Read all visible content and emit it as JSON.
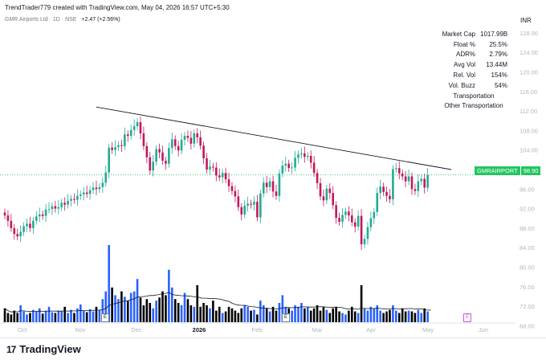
{
  "header": {
    "attribution": "TrendTrader779 created with TradingView.com, May 04, 2026 16:57 UTC+5:30",
    "symbol_line": "GMR Airports Ltd · 1D · NSE",
    "change": "+2.47 (+2.56%)",
    "currency": "INR"
  },
  "stats": [
    {
      "label": "Market Cap",
      "value": "1017.99B"
    },
    {
      "label": "Float %",
      "value": "25.5%"
    },
    {
      "label": "ADR%",
      "value": "2.79%"
    },
    {
      "label": "Avg Vol",
      "value": "13.44M"
    },
    {
      "label": "Rel. Vol",
      "value": "154%"
    },
    {
      "label": "Vol. Buzz",
      "value": "54%"
    }
  ],
  "sector": "Transportation",
  "industry": "Other Transportation",
  "price_tag": {
    "symbol": "GMRAIRPORT",
    "value": "98.90"
  },
  "earnings_marker": "E",
  "brand": {
    "mark": "17",
    "name": "TradingView"
  },
  "colors": {
    "up": "#22ab94",
    "down": "#c2185b",
    "up_vol": "#2962ff",
    "down_vol": "#000000",
    "trendline": "#131722",
    "price_line": "#22c55e",
    "axis_text": "#b2b5be"
  },
  "chart_data": {
    "type": "candlestick",
    "y_axis_ticks": [
      68,
      72,
      76,
      80,
      84,
      88,
      92,
      96,
      100,
      104,
      108,
      112,
      116,
      120,
      124,
      128
    ],
    "x_axis_ticks": [
      "Oct",
      "Nov",
      "Dec",
      "2026",
      "Feb",
      "Mar",
      "Apr",
      "May",
      "Jun"
    ],
    "ylim": [
      68,
      130
    ],
    "last_price": 98.9,
    "trendline": [
      {
        "date": "2025-11-14",
        "price": 112.8
      },
      {
        "date": "2026-05-15",
        "price": 100.0
      }
    ],
    "closes": [
      90.6,
      89.5,
      88.0,
      86.8,
      86.3,
      87.2,
      88.4,
      88.9,
      88.0,
      89.5,
      90.4,
      90.8,
      90.5,
      91.8,
      91.9,
      92.5,
      92.0,
      92.3,
      93.2,
      92.8,
      93.6,
      94.0,
      93.8,
      94.6,
      94.9,
      95.3,
      95.0,
      95.8,
      96.3,
      96.0,
      96.4,
      97.3,
      99.4,
      104.5,
      104.0,
      104.6,
      105.0,
      104.8,
      107.2,
      106.9,
      108.1,
      108.9,
      109.7,
      107.4,
      104.8,
      102.5,
      99.8,
      101.6,
      104.2,
      103.5,
      101.8,
      101.2,
      104.4,
      106.2,
      104.8,
      103.9,
      106.1,
      106.9,
      106.5,
      105.3,
      107.4,
      106.6,
      104.9,
      102.3,
      100.0,
      100.6,
      100.4,
      98.8,
      98.4,
      99.3,
      98.0,
      96.6,
      95.6,
      94.5,
      92.3,
      90.8,
      92.6,
      93.0,
      92.8,
      93.4,
      90.2,
      95.1,
      97.3,
      96.4,
      97.6,
      95.5,
      94.6,
      99.2,
      100.8,
      101.2,
      100.3,
      100.4,
      102.4,
      103.1,
      103.3,
      102.6,
      102.8,
      101.4,
      99.3,
      97.2,
      94.5,
      93.7,
      96.1,
      95.2,
      92.7,
      90.1,
      89.3,
      90.7,
      91.4,
      90.6,
      89.2,
      88.3,
      90.5,
      84.7,
      85.8,
      88.2,
      90.0,
      91.3,
      95.2,
      96.5,
      95.4,
      94.6,
      93.9,
      100.1,
      100.3,
      99.2,
      98.6,
      97.6,
      98.6,
      96.0,
      95.6,
      97.6,
      98.1,
      96.3,
      98.9
    ],
    "volume_scale": [
      0.18,
      0.12,
      0.1,
      0.15,
      0.12,
      0.22,
      0.14,
      0.1,
      0.12,
      0.16,
      0.14,
      0.18,
      0.11,
      0.15,
      0.2,
      0.13,
      0.12,
      0.15,
      0.14,
      0.2,
      0.12,
      0.16,
      0.12,
      0.18,
      0.23,
      0.15,
      0.13,
      0.17,
      0.14,
      0.2,
      0.16,
      0.3,
      0.4,
      1.0,
      0.45,
      0.35,
      0.3,
      0.4,
      0.33,
      0.28,
      0.38,
      0.4,
      0.56,
      0.32,
      0.22,
      0.3,
      0.25,
      0.18,
      0.28,
      0.32,
      0.4,
      0.35,
      0.68,
      0.45,
      0.3,
      0.25,
      0.22,
      0.38,
      0.3,
      0.22,
      0.2,
      0.48,
      0.2,
      0.25,
      0.22,
      0.18,
      0.28,
      0.15,
      0.2,
      0.12,
      0.14,
      0.2,
      0.18,
      0.15,
      0.12,
      0.18,
      0.22,
      0.2,
      0.15,
      0.16,
      0.1,
      0.28,
      0.22,
      0.18,
      0.14,
      0.2,
      0.15,
      0.25,
      0.35,
      0.2,
      0.18,
      0.15,
      0.22,
      0.2,
      0.25,
      0.18,
      0.2,
      0.15,
      0.18,
      0.22,
      0.15,
      0.2,
      0.16,
      0.12,
      0.18,
      0.2,
      0.14,
      0.12,
      0.1,
      0.15,
      0.2,
      0.14,
      0.12,
      0.48,
      0.18,
      0.15,
      0.2,
      0.18,
      0.22,
      0.15,
      0.12,
      0.14,
      0.16,
      0.22,
      0.15,
      0.12,
      0.18,
      0.14,
      0.15,
      0.14,
      0.12,
      0.16,
      0.12,
      0.18,
      0.14,
      0.16
    ]
  }
}
